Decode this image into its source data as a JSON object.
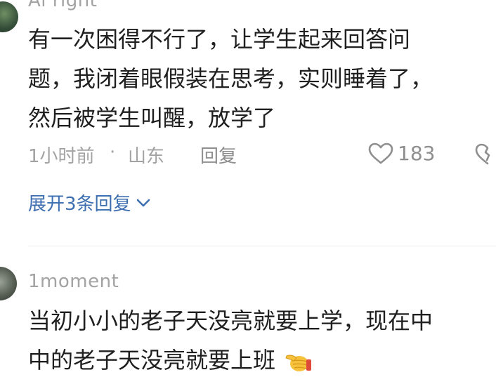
{
  "comments": [
    {
      "username": "Ai right",
      "text_lines": [
        "有一次困得不行了，让学生起来回答问",
        "题，我闭着眼假装在思考，实则睡着了，",
        "然后被学生叫醒，放学了"
      ],
      "time": "1小时前",
      "separator": "·",
      "location": "山东",
      "reply_label": "回复",
      "like_count": "183",
      "expand_label": "展开3条回复"
    },
    {
      "username": "1moment",
      "text_lines": [
        "当初小小的老子天没亮就要上学，现在中",
        "中的老子天没亮就要上班"
      ],
      "emoji": "pointing-hand-emoji"
    }
  ],
  "colors": {
    "link": "#3d6fb0",
    "muted": "#a3a3a3",
    "text": "#1f1f1f"
  }
}
